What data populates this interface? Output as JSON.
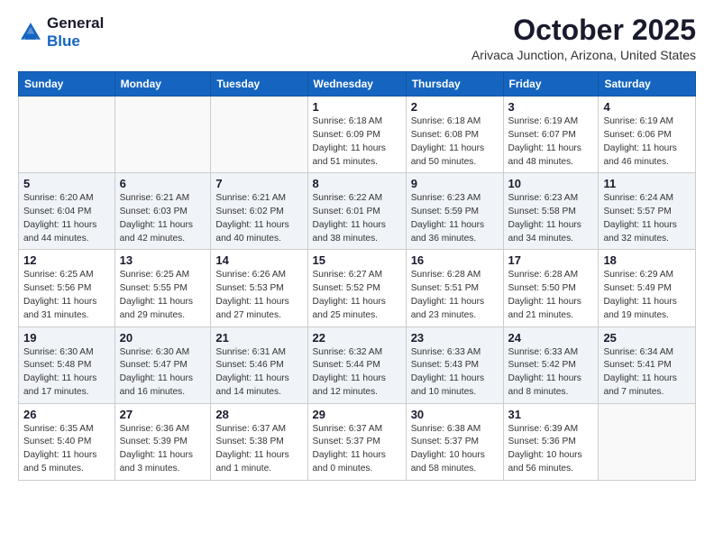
{
  "header": {
    "logo_line1": "General",
    "logo_line2": "Blue",
    "month": "October 2025",
    "location": "Arivaca Junction, Arizona, United States"
  },
  "weekdays": [
    "Sunday",
    "Monday",
    "Tuesday",
    "Wednesday",
    "Thursday",
    "Friday",
    "Saturday"
  ],
  "weeks": [
    [
      {
        "day": "",
        "info": ""
      },
      {
        "day": "",
        "info": ""
      },
      {
        "day": "",
        "info": ""
      },
      {
        "day": "1",
        "info": "Sunrise: 6:18 AM\nSunset: 6:09 PM\nDaylight: 11 hours\nand 51 minutes."
      },
      {
        "day": "2",
        "info": "Sunrise: 6:18 AM\nSunset: 6:08 PM\nDaylight: 11 hours\nand 50 minutes."
      },
      {
        "day": "3",
        "info": "Sunrise: 6:19 AM\nSunset: 6:07 PM\nDaylight: 11 hours\nand 48 minutes."
      },
      {
        "day": "4",
        "info": "Sunrise: 6:19 AM\nSunset: 6:06 PM\nDaylight: 11 hours\nand 46 minutes."
      }
    ],
    [
      {
        "day": "5",
        "info": "Sunrise: 6:20 AM\nSunset: 6:04 PM\nDaylight: 11 hours\nand 44 minutes."
      },
      {
        "day": "6",
        "info": "Sunrise: 6:21 AM\nSunset: 6:03 PM\nDaylight: 11 hours\nand 42 minutes."
      },
      {
        "day": "7",
        "info": "Sunrise: 6:21 AM\nSunset: 6:02 PM\nDaylight: 11 hours\nand 40 minutes."
      },
      {
        "day": "8",
        "info": "Sunrise: 6:22 AM\nSunset: 6:01 PM\nDaylight: 11 hours\nand 38 minutes."
      },
      {
        "day": "9",
        "info": "Sunrise: 6:23 AM\nSunset: 5:59 PM\nDaylight: 11 hours\nand 36 minutes."
      },
      {
        "day": "10",
        "info": "Sunrise: 6:23 AM\nSunset: 5:58 PM\nDaylight: 11 hours\nand 34 minutes."
      },
      {
        "day": "11",
        "info": "Sunrise: 6:24 AM\nSunset: 5:57 PM\nDaylight: 11 hours\nand 32 minutes."
      }
    ],
    [
      {
        "day": "12",
        "info": "Sunrise: 6:25 AM\nSunset: 5:56 PM\nDaylight: 11 hours\nand 31 minutes."
      },
      {
        "day": "13",
        "info": "Sunrise: 6:25 AM\nSunset: 5:55 PM\nDaylight: 11 hours\nand 29 minutes."
      },
      {
        "day": "14",
        "info": "Sunrise: 6:26 AM\nSunset: 5:53 PM\nDaylight: 11 hours\nand 27 minutes."
      },
      {
        "day": "15",
        "info": "Sunrise: 6:27 AM\nSunset: 5:52 PM\nDaylight: 11 hours\nand 25 minutes."
      },
      {
        "day": "16",
        "info": "Sunrise: 6:28 AM\nSunset: 5:51 PM\nDaylight: 11 hours\nand 23 minutes."
      },
      {
        "day": "17",
        "info": "Sunrise: 6:28 AM\nSunset: 5:50 PM\nDaylight: 11 hours\nand 21 minutes."
      },
      {
        "day": "18",
        "info": "Sunrise: 6:29 AM\nSunset: 5:49 PM\nDaylight: 11 hours\nand 19 minutes."
      }
    ],
    [
      {
        "day": "19",
        "info": "Sunrise: 6:30 AM\nSunset: 5:48 PM\nDaylight: 11 hours\nand 17 minutes."
      },
      {
        "day": "20",
        "info": "Sunrise: 6:30 AM\nSunset: 5:47 PM\nDaylight: 11 hours\nand 16 minutes."
      },
      {
        "day": "21",
        "info": "Sunrise: 6:31 AM\nSunset: 5:46 PM\nDaylight: 11 hours\nand 14 minutes."
      },
      {
        "day": "22",
        "info": "Sunrise: 6:32 AM\nSunset: 5:44 PM\nDaylight: 11 hours\nand 12 minutes."
      },
      {
        "day": "23",
        "info": "Sunrise: 6:33 AM\nSunset: 5:43 PM\nDaylight: 11 hours\nand 10 minutes."
      },
      {
        "day": "24",
        "info": "Sunrise: 6:33 AM\nSunset: 5:42 PM\nDaylight: 11 hours\nand 8 minutes."
      },
      {
        "day": "25",
        "info": "Sunrise: 6:34 AM\nSunset: 5:41 PM\nDaylight: 11 hours\nand 7 minutes."
      }
    ],
    [
      {
        "day": "26",
        "info": "Sunrise: 6:35 AM\nSunset: 5:40 PM\nDaylight: 11 hours\nand 5 minutes."
      },
      {
        "day": "27",
        "info": "Sunrise: 6:36 AM\nSunset: 5:39 PM\nDaylight: 11 hours\nand 3 minutes."
      },
      {
        "day": "28",
        "info": "Sunrise: 6:37 AM\nSunset: 5:38 PM\nDaylight: 11 hours\nand 1 minute."
      },
      {
        "day": "29",
        "info": "Sunrise: 6:37 AM\nSunset: 5:37 PM\nDaylight: 11 hours\nand 0 minutes."
      },
      {
        "day": "30",
        "info": "Sunrise: 6:38 AM\nSunset: 5:37 PM\nDaylight: 10 hours\nand 58 minutes."
      },
      {
        "day": "31",
        "info": "Sunrise: 6:39 AM\nSunset: 5:36 PM\nDaylight: 10 hours\nand 56 minutes."
      },
      {
        "day": "",
        "info": ""
      }
    ]
  ]
}
